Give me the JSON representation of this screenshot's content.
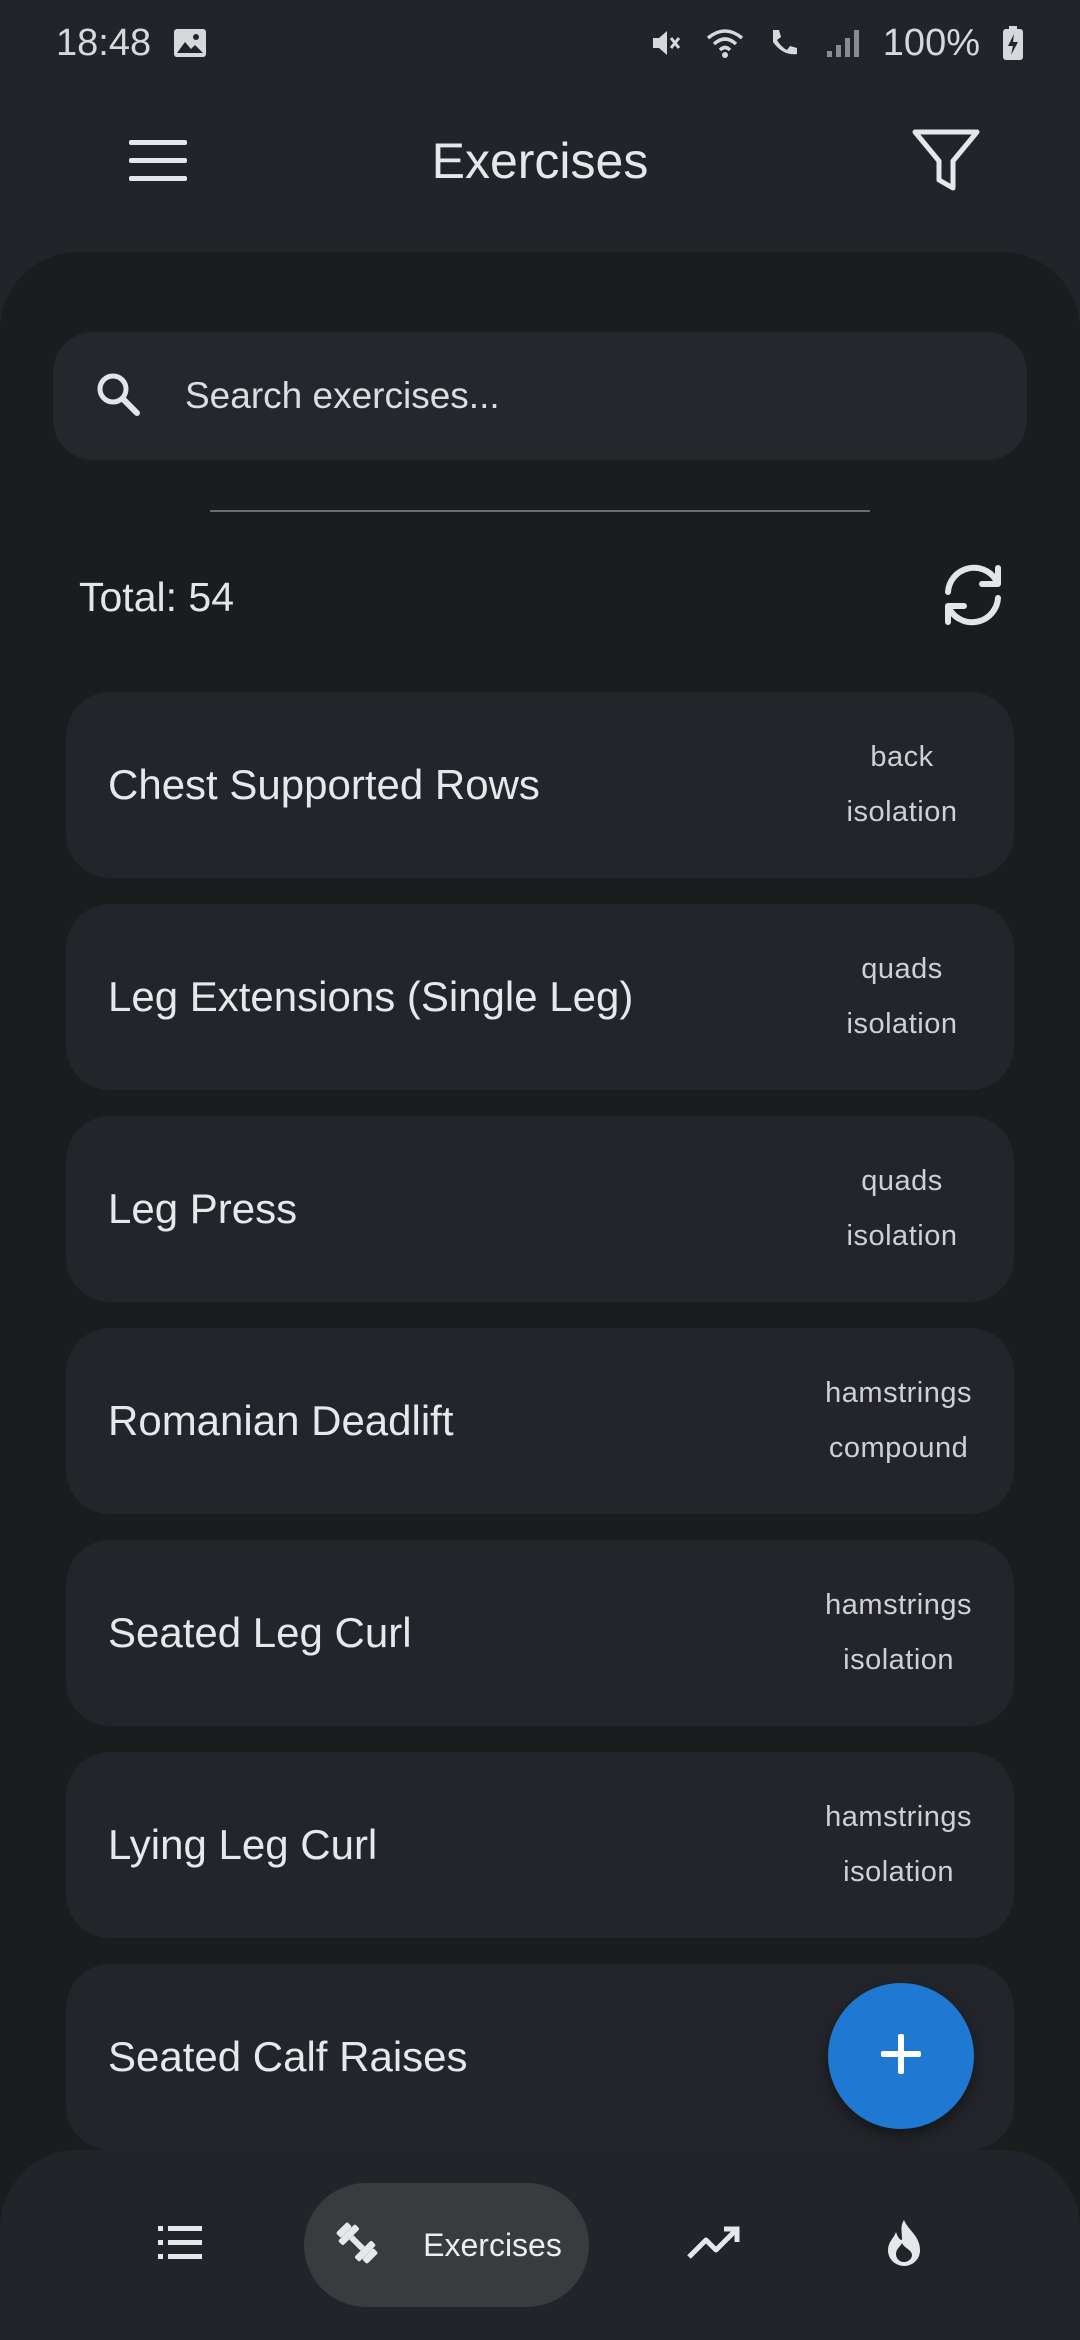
{
  "status_bar": {
    "time": "18:48",
    "battery": "100%",
    "icons": [
      "gallery-icon",
      "mute-icon",
      "wifi-icon",
      "wifi-call-icon",
      "signal-icon",
      "battery-charging-icon"
    ]
  },
  "app_bar": {
    "title": "Exercises",
    "menu_icon": "hamburger-menu-icon",
    "filter_icon": "filter-icon"
  },
  "search": {
    "placeholder": "Search exercises..."
  },
  "summary": {
    "total_label": "Total: 54",
    "refresh_icon": "refresh-icon"
  },
  "exercises": [
    {
      "name": "Chest Supported Rows",
      "muscle": "back",
      "type": "isolation"
    },
    {
      "name": "Leg Extensions (Single Leg)",
      "muscle": "quads",
      "type": "isolation"
    },
    {
      "name": "Leg Press",
      "muscle": "quads",
      "type": "isolation"
    },
    {
      "name": "Romanian Deadlift",
      "muscle": "hamstrings",
      "type": "compound"
    },
    {
      "name": "Seated Leg Curl",
      "muscle": "hamstrings",
      "type": "isolation"
    },
    {
      "name": "Lying Leg Curl",
      "muscle": "hamstrings",
      "type": "isolation"
    },
    {
      "name": "Seated Calf Raises",
      "muscle": "",
      "type": ""
    }
  ],
  "fab": {
    "icon": "plus-icon"
  },
  "bottom_nav": {
    "items": [
      {
        "icon": "list-icon",
        "label": ""
      },
      {
        "icon": "dumbbell-icon",
        "label": "Exercises",
        "active": true
      },
      {
        "icon": "trending-up-icon",
        "label": ""
      },
      {
        "icon": "flame-icon",
        "label": ""
      }
    ]
  },
  "colors": {
    "background": "#1b1c1e",
    "surface": "#23252a",
    "accent": "#1f78d1",
    "text": "#e7e8ec"
  }
}
